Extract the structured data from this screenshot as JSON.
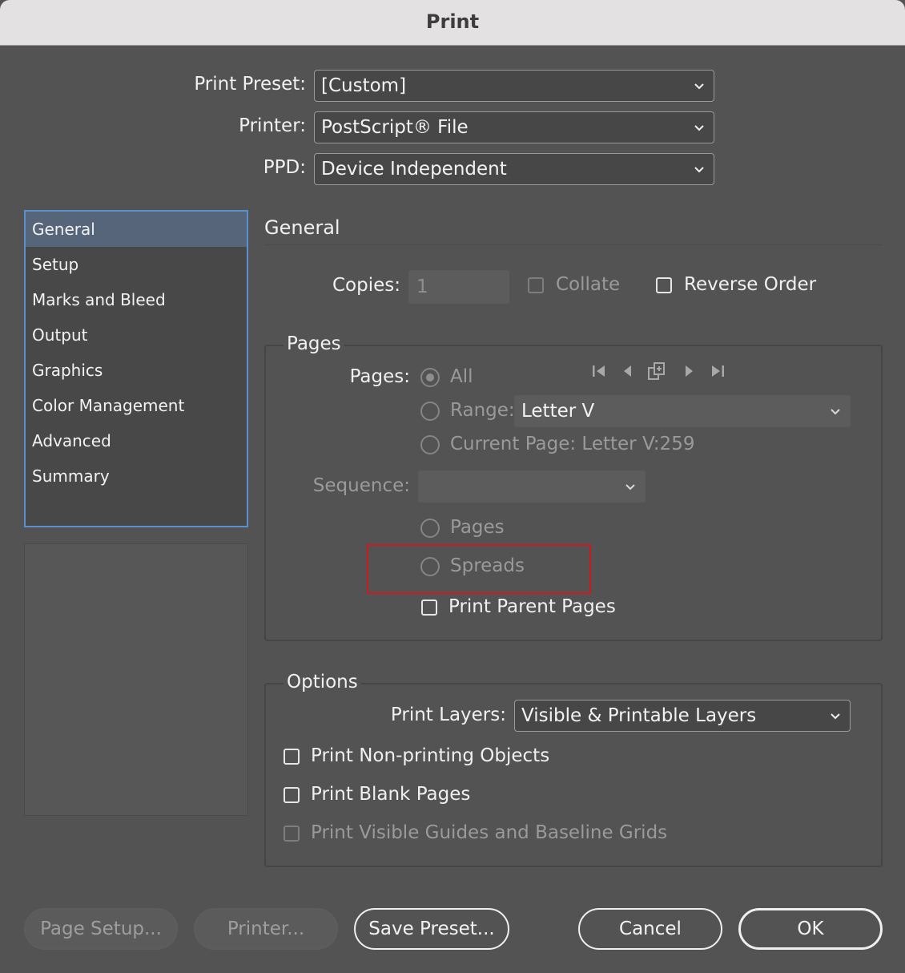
{
  "window": {
    "title": "Print"
  },
  "top": {
    "preset_label": "Print Preset:",
    "preset_value": "[Custom]",
    "printer_label": "Printer:",
    "printer_value": "PostScript® File",
    "ppd_label": "PPD:",
    "ppd_value": "Device Independent"
  },
  "sidebar": {
    "items": [
      {
        "label": "General",
        "selected": true
      },
      {
        "label": "Setup"
      },
      {
        "label": "Marks and Bleed"
      },
      {
        "label": "Output"
      },
      {
        "label": "Graphics"
      },
      {
        "label": "Color Management"
      },
      {
        "label": "Advanced"
      },
      {
        "label": "Summary"
      }
    ]
  },
  "general": {
    "section_title": "General",
    "copies_label": "Copies:",
    "copies_value": "1",
    "collate_label": "Collate",
    "collate_checked": false,
    "reverse_label": "Reverse Order",
    "reverse_checked": false
  },
  "pages": {
    "group_title": "Pages",
    "pages_label": "Pages:",
    "all_label": "All",
    "range_label": "Range:",
    "range_value": "Letter V",
    "current_page_label": "Current Page: Letter V:259",
    "selected": "All",
    "nav_icons": [
      "first-page-icon",
      "previous-page-icon",
      "spread-icon",
      "next-page-icon",
      "last-page-icon"
    ],
    "sequence_label": "Sequence:",
    "sequence_value": "",
    "pages_option": "Pages",
    "spreads_option": "Spreads",
    "print_parent_label": "Print Parent Pages",
    "print_parent_checked": false
  },
  "options": {
    "group_title": "Options",
    "layers_label": "Print Layers:",
    "layers_value": "Visible & Printable Layers",
    "nonprinting_label": "Print Non-printing Objects",
    "blank_label": "Print Blank Pages",
    "guides_label": "Print Visible Guides and Baseline Grids"
  },
  "buttons": {
    "page_setup": "Page Setup...",
    "printer": "Printer...",
    "save_preset": "Save Preset...",
    "cancel": "Cancel",
    "ok": "OK"
  },
  "colors": {
    "highlight": "#d0191b",
    "selection": "#56657a",
    "focus": "#5b8fd0"
  }
}
